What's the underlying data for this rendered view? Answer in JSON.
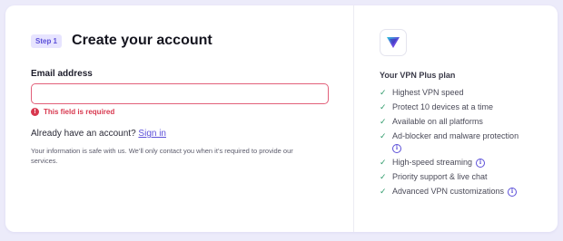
{
  "signup": {
    "step_label": "Step 1",
    "title": "Create your account",
    "email_label": "Email address",
    "email_value": "",
    "error_text": "This field is required",
    "signin_prompt": "Already have an account?",
    "signin_link": "Sign in",
    "info_text": "Your information is safe with us. We’ll only contact you when it’s required to provide our services."
  },
  "plan": {
    "title": "Your VPN Plus plan",
    "features": [
      {
        "label": "Highest VPN speed",
        "info": false
      },
      {
        "label": "Protect 10 devices at a time",
        "info": false
      },
      {
        "label": "Available on all platforms",
        "info": false
      },
      {
        "label": "Ad-blocker and malware protection",
        "info": true
      },
      {
        "label": "High-speed streaming",
        "info": true
      },
      {
        "label": "Priority support & live chat",
        "info": false
      },
      {
        "label": "Advanced VPN customizations",
        "info": true
      }
    ]
  },
  "colors": {
    "accent": "#5b4fd8",
    "error": "#d8384f",
    "check": "#2f9a6a",
    "background": "#ecebfa"
  },
  "icons": {
    "error": "error-icon",
    "check": "check-icon",
    "info": "info-icon",
    "logo": "vpn-logo-icon"
  }
}
